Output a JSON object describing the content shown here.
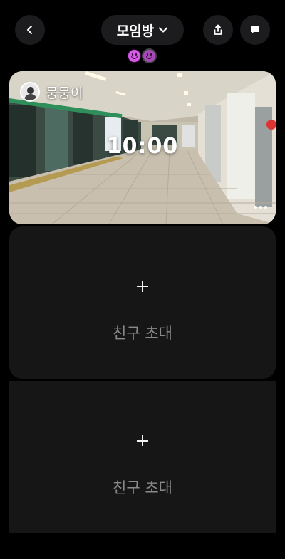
{
  "header": {
    "title": "모임방",
    "icons": {
      "back": "chevron-left-icon",
      "dropdown": "chevron-down-icon",
      "share": "share-icon",
      "chat": "chat-bubble-icon"
    }
  },
  "reactions": [
    "smiley",
    "smiley"
  ],
  "post": {
    "username": "뭉뭉이",
    "time": "10:00"
  },
  "invite_slots": [
    {
      "label": "친구 초대"
    },
    {
      "label": "친구 초대"
    }
  ],
  "colors": {
    "background": "#000000",
    "surface": "#1c1c1e",
    "card": "#161616",
    "accent": "#d65be6",
    "muted_text": "#8a8a8a"
  }
}
